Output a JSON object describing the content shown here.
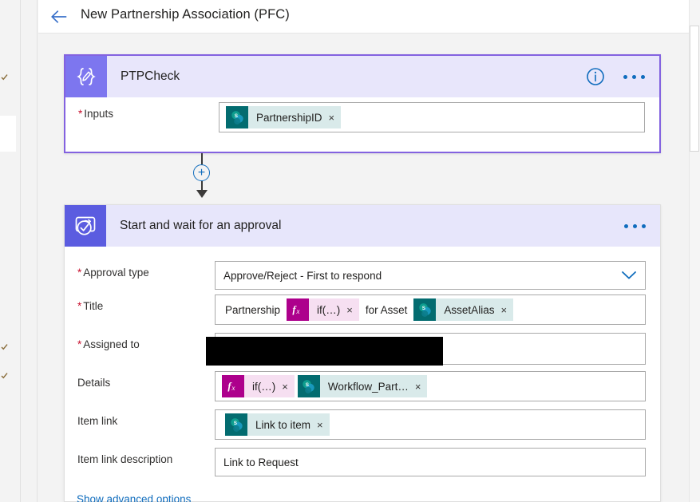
{
  "window": {
    "background": "#f3f3f3"
  },
  "header": {
    "back_label": "Back",
    "back_icon": "arrow-left-icon",
    "title": "New Partnership Association (PFC)"
  },
  "colors": {
    "accent_purple": "#7d76ef",
    "accent_indigo": "#5b5ce0",
    "card_header_bg": "#e8e6fb",
    "selected_border": "#8362e0",
    "link_blue": "#0f6cbd",
    "sharepoint_teal": "#036c70",
    "sharepoint_token_bg": "#d9eaea",
    "expression_magenta": "#ad008c",
    "expression_token_bg": "#f6dff1",
    "required_red": "#c8102e"
  },
  "cards": [
    {
      "id": "ptpcheck",
      "title": "PTPCheck",
      "icon": "expression-braces-pen-icon",
      "selected": true,
      "header_actions": {
        "info_label": "i",
        "info_icon": "info-circle-icon",
        "more_icon": "ellipsis-icon"
      },
      "rows": [
        {
          "label": "Inputs",
          "required": true,
          "type": "tokens",
          "tokens": [
            {
              "kind": "sharepoint",
              "icon": "sharepoint-icon",
              "text": "PartnershipID",
              "remove": "×"
            }
          ]
        }
      ]
    },
    {
      "id": "approval",
      "title": "Start and wait for an approval",
      "icon": "approval-check-icon",
      "selected": false,
      "header_actions": {
        "more_icon": "ellipsis-icon"
      },
      "rows": [
        {
          "label": "Approval type",
          "required": true,
          "type": "dropdown",
          "value": "Approve/Reject - First to respond",
          "chevron": "chevron-down-icon"
        },
        {
          "label": "Title",
          "required": true,
          "type": "mixed",
          "parts": [
            {
              "kind": "text",
              "text": "Partnership"
            },
            {
              "kind": "expression",
              "icon": "fx-icon",
              "text": "if(…)",
              "remove": "×"
            },
            {
              "kind": "text",
              "text": "for Asset"
            },
            {
              "kind": "sharepoint",
              "icon": "sharepoint-icon",
              "text": "AssetAlias",
              "remove": "×"
            }
          ]
        },
        {
          "label": "Assigned to",
          "required": true,
          "type": "redacted",
          "redacted": true
        },
        {
          "label": "Details",
          "required": false,
          "type": "tokens",
          "tokens": [
            {
              "kind": "expression",
              "icon": "fx-icon",
              "text": "if(…)",
              "remove": "×"
            },
            {
              "kind": "sharepoint",
              "icon": "sharepoint-icon",
              "text": "Workflow_Part…",
              "remove": "×"
            }
          ]
        },
        {
          "label": "Item link",
          "required": false,
          "type": "tokens",
          "tokens": [
            {
              "kind": "sharepoint",
              "icon": "sharepoint-icon",
              "text": "Link to item",
              "remove": "×"
            }
          ]
        },
        {
          "label": "Item link description",
          "required": false,
          "type": "text",
          "value": "Link to Request"
        }
      ],
      "advanced_link": "Show advanced options"
    }
  ],
  "connector": {
    "add_label": "+",
    "add_icon": "plus-circle-icon"
  },
  "scrollbar": {
    "orientation": "vertical"
  }
}
